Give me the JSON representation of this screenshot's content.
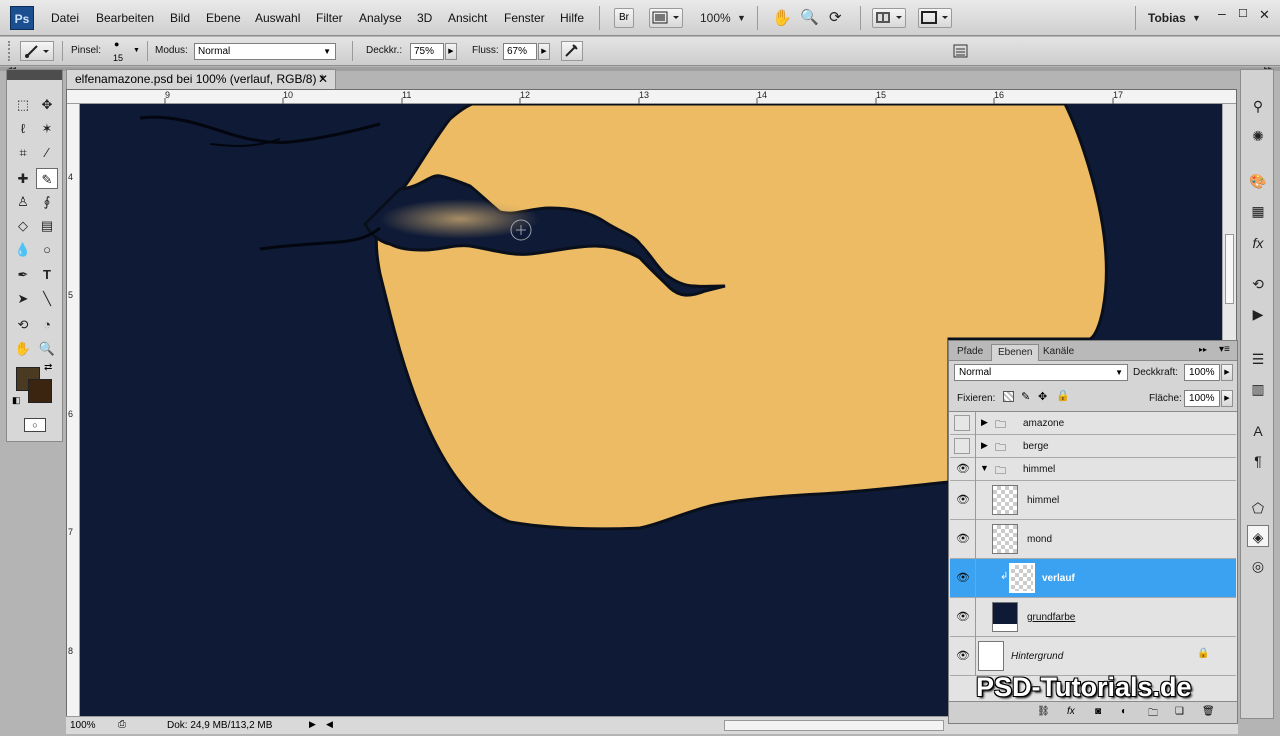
{
  "app": {
    "logo": "Ps",
    "menu": [
      "Datei",
      "Bearbeiten",
      "Bild",
      "Ebene",
      "Auswahl",
      "Filter",
      "Analyse",
      "3D",
      "Ansicht",
      "Fenster",
      "Hilfe"
    ],
    "bridge_label": "Br",
    "zoom": "100%",
    "user": "Tobias"
  },
  "options": {
    "brush_label": "Pinsel:",
    "brush_size": "15",
    "mode_label": "Modus:",
    "mode_value": "Normal",
    "opacity_label": "Deckkr.:",
    "opacity_value": "75%",
    "flow_label": "Fluss:",
    "flow_value": "67%"
  },
  "document": {
    "tab_title": "elfenamazone.psd bei 100% (verlauf, RGB/8) *",
    "ruler_top": [
      "9",
      "10",
      "11",
      "12",
      "13",
      "14",
      "15",
      "16",
      "17"
    ],
    "ruler_left": [
      "4",
      "5",
      "6",
      "7",
      "8"
    ],
    "colors": {
      "sky": "#0e1a36",
      "moon": "#ecbb63",
      "outline": "#0a0f1c"
    }
  },
  "status": {
    "zoom": "100%",
    "doc_info": "Dok: 24,9 MB/113,2 MB"
  },
  "layers_panel": {
    "tabs": [
      "Pfade",
      "Ebenen",
      "Kanäle"
    ],
    "active_tab": "Ebenen",
    "blend_mode": "Normal",
    "opacity_label": "Deckkraft:",
    "opacity": "100%",
    "lock_label": "Fixieren:",
    "fill_label": "Fläche:",
    "fill": "100%",
    "layers": [
      {
        "name": "amazone",
        "type": "group",
        "visible": false,
        "expanded": false
      },
      {
        "name": "berge",
        "type": "group",
        "visible": false,
        "expanded": false
      },
      {
        "name": "himmel",
        "type": "group",
        "visible": true,
        "expanded": true
      },
      {
        "name": "himmel",
        "type": "layer",
        "visible": true
      },
      {
        "name": "mond",
        "type": "layer",
        "visible": true
      },
      {
        "name": "verlauf",
        "type": "layer",
        "visible": true,
        "selected": true,
        "clipped": true
      },
      {
        "name": "grundfarbe",
        "type": "layer",
        "visible": true
      },
      {
        "name": "Hintergrund",
        "type": "layer",
        "visible": true,
        "locked": true
      }
    ]
  },
  "watermark": "PSD-Tutorials.de"
}
